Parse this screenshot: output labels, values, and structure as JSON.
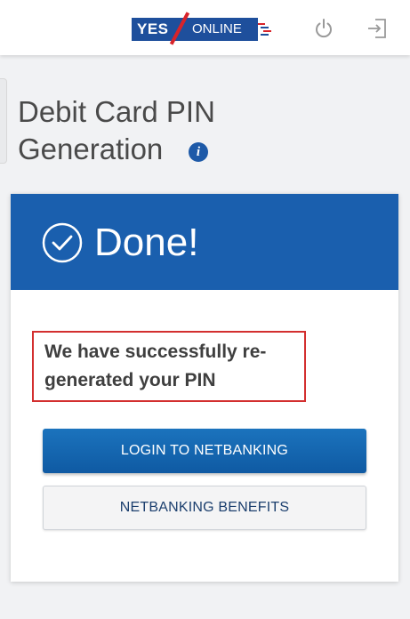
{
  "header": {
    "logo": {
      "yes": "YES",
      "online": "ONLINE"
    },
    "icons": {
      "power": "power-icon",
      "logout": "logout-icon"
    }
  },
  "page": {
    "title": "Debit Card PIN Generation",
    "info_icon": "info-icon"
  },
  "card": {
    "status": "Done!",
    "status_icon": "check-circle-icon",
    "message": "We have successfully re-generated your PIN",
    "primary_button": "LOGIN TO NETBANKING",
    "secondary_button": "NETBANKING BENEFITS"
  },
  "colors": {
    "brand_blue": "#1a5fae",
    "logo_blue": "#1e4f9c",
    "logo_red": "#d8232a",
    "highlight_red": "#d32f2f",
    "button_blue": "#1b73bd"
  }
}
